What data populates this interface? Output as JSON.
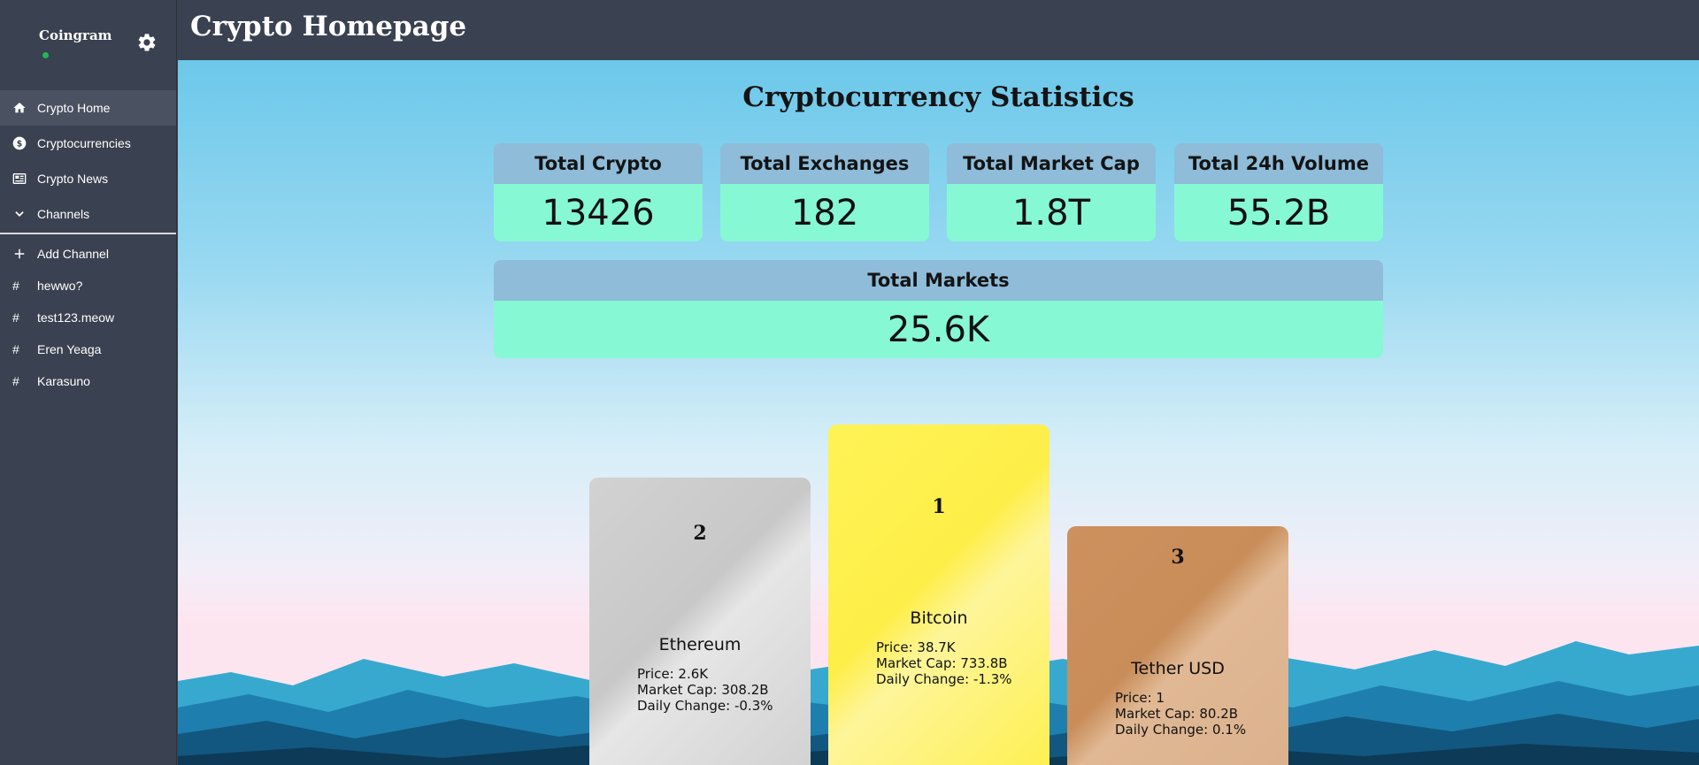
{
  "app": {
    "name": "Coingram",
    "page_title": "Crypto Homepage"
  },
  "sidebar": {
    "nav": [
      {
        "label": "Crypto Home",
        "icon": "home-icon",
        "active": true
      },
      {
        "label": "Cryptocurrencies",
        "icon": "dollar-icon"
      },
      {
        "label": "Crypto News",
        "icon": "newspaper-icon"
      },
      {
        "label": "Channels",
        "icon": "chevron-down-icon"
      }
    ],
    "add_channel": "Add Channel",
    "channels": [
      "hewwo?",
      "test123.meow",
      "Eren Yeaga",
      "Karasuno"
    ]
  },
  "stats": {
    "title": "Cryptocurrency Statistics",
    "cards": [
      {
        "label": "Total Crypto",
        "value": "13426"
      },
      {
        "label": "Total Exchanges",
        "value": "182"
      },
      {
        "label": "Total Market Cap",
        "value": "1.8T"
      },
      {
        "label": "Total 24h Volume",
        "value": "55.2B"
      }
    ],
    "markets": {
      "label": "Total Markets",
      "value": "25.6K"
    }
  },
  "podium": {
    "first": {
      "rank": "1",
      "name": "Bitcoin",
      "price": "Price: 38.7K",
      "market_cap": "Market Cap: 733.8B",
      "change": "Daily Change: -1.3%"
    },
    "second": {
      "rank": "2",
      "name": "Ethereum",
      "price": "Price: 2.6K",
      "market_cap": "Market Cap: 308.2B",
      "change": "Daily Change: -0.3%"
    },
    "third": {
      "rank": "3",
      "name": "Tether USD",
      "price": "Price: 1",
      "market_cap": "Market Cap: 80.2B",
      "change": "Daily Change: 0.1%"
    }
  },
  "colors": {
    "sidebar": "#3a4150",
    "stat_header": "#8ebcd9",
    "stat_value": "#87f8d4",
    "gold": "#fef053",
    "silver": "#d4d4d4",
    "bronze": "#d09b6b"
  }
}
